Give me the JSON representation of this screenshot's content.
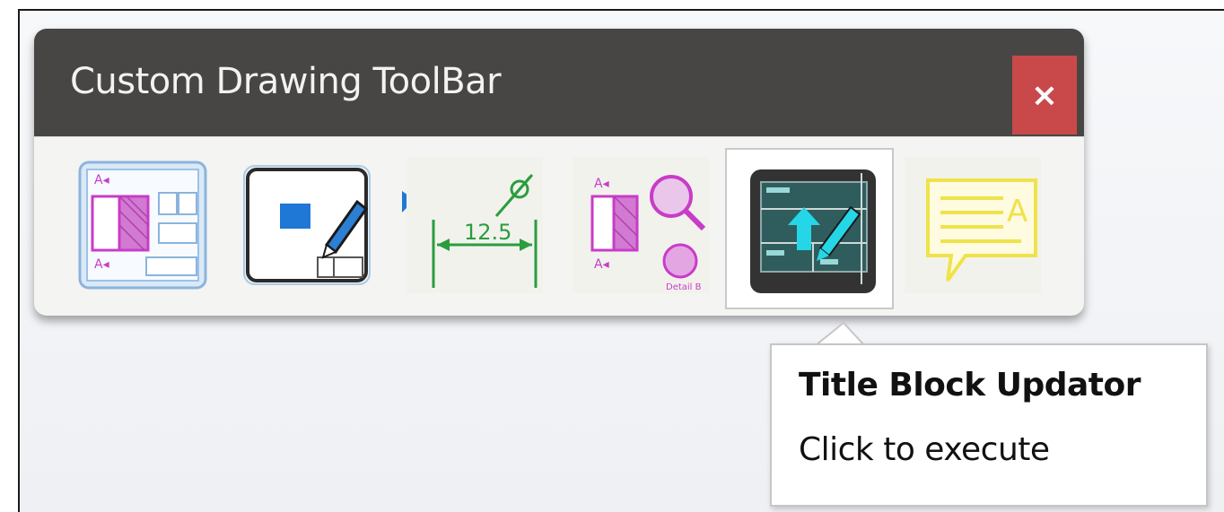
{
  "toolbar": {
    "title": "Custom Drawing ToolBar",
    "close_label": "×",
    "close_color": "#c9494a",
    "titlebar_color": "#474645",
    "tools": [
      {
        "icon": "section-view-icon",
        "selected": false
      },
      {
        "icon": "edit-sheet-icon",
        "selected": false
      },
      {
        "icon": "dimension-icon",
        "selected": false
      },
      {
        "icon": "detail-view-icon",
        "selected": false
      },
      {
        "icon": "title-block-updator-icon",
        "selected": true
      },
      {
        "icon": "note-annotation-icon",
        "selected": false
      }
    ]
  },
  "tooltip": {
    "title": "Title Block Updator",
    "subtitle": "Click to execute"
  },
  "dimension_label": "12.5"
}
